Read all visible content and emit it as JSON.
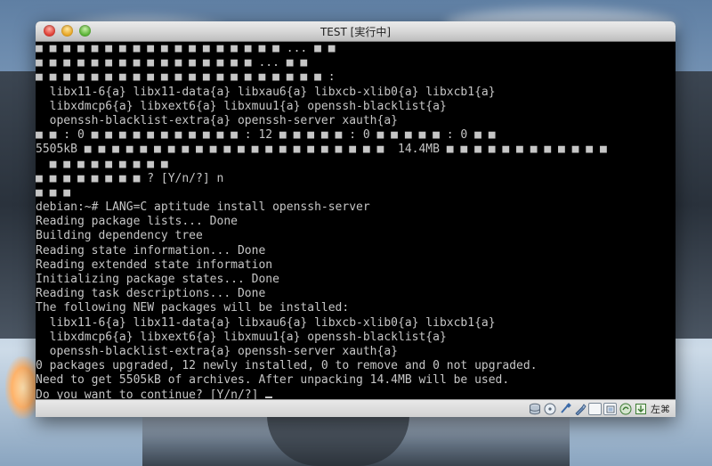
{
  "window": {
    "title": "TEST [実行中]"
  },
  "console": {
    "lines": [
      "■ ■ ■ ■ ■ ■ ■ ■ ■ ■ ■ ■ ■ ■ ■ ■ ■ ■ ... ■ ■",
      "■ ■ ■ ■ ■ ■ ■ ■ ■ ■ ■ ■ ■ ■ ■ ■ ... ■ ■",
      "■ ■ ■ ■ ■ ■ ■ ■ ■ ■ ■ ■ ■ ■ ■ ■ ■ ■ ■ ■ ■ :",
      "  libx11-6{a} libx11-data{a} libxau6{a} libxcb-xlib0{a} libxcb1{a}",
      "  libxdmcp6{a} libxext6{a} libxmuu1{a} openssh-blacklist{a}",
      "  openssh-blacklist-extra{a} openssh-server xauth{a}",
      "■ ■ : 0 ■ ■ ■ ■ ■ ■ ■ ■ ■ ■ ■ : 12 ■ ■ ■ ■ ■ : 0 ■ ■ ■ ■ ■ : 0 ■ ■",
      "5505kB ■ ■ ■ ■ ■ ■ ■ ■ ■ ■ ■ ■ ■ ■ ■ ■ ■ ■ ■ ■ ■ ■  14.4MB ■ ■ ■ ■ ■ ■ ■ ■ ■ ■ ■ ■",
      "  ■ ■ ■ ■ ■ ■ ■ ■ ■",
      "■ ■ ■ ■ ■ ■ ■ ■ ? [Y/n/?] n",
      "■ ■ ■",
      "debian:~# LANG=C aptitude install openssh-server",
      "Reading package lists... Done",
      "Building dependency tree",
      "Reading state information... Done",
      "Reading extended state information",
      "Initializing package states... Done",
      "Reading task descriptions... Done",
      "The following NEW packages will be installed:",
      "  libx11-6{a} libx11-data{a} libxau6{a} libxcb-xlib0{a} libxcb1{a}",
      "  libxdmcp6{a} libxext6{a} libxmuu1{a} openssh-blacklist{a}",
      "  openssh-blacklist-extra{a} openssh-server xauth{a}",
      "0 packages upgraded, 12 newly installed, 0 to remove and 0 not upgraded.",
      "Need to get 5505kB of archives. After unpacking 14.4MB will be used.",
      "Do you want to continue? [Y/n/?] "
    ]
  },
  "statusbar": {
    "icons": [
      "hard-disk-icon",
      "optical-drive-icon",
      "usb-icon",
      "shared-folder-icon",
      "display-icon",
      "network-icon",
      "virtualization-icon",
      "mouse-integration-icon"
    ],
    "host_key": "左⌘"
  },
  "colors": {
    "terminal_bg": "#000000",
    "terminal_fg": "#c6c6c6"
  }
}
